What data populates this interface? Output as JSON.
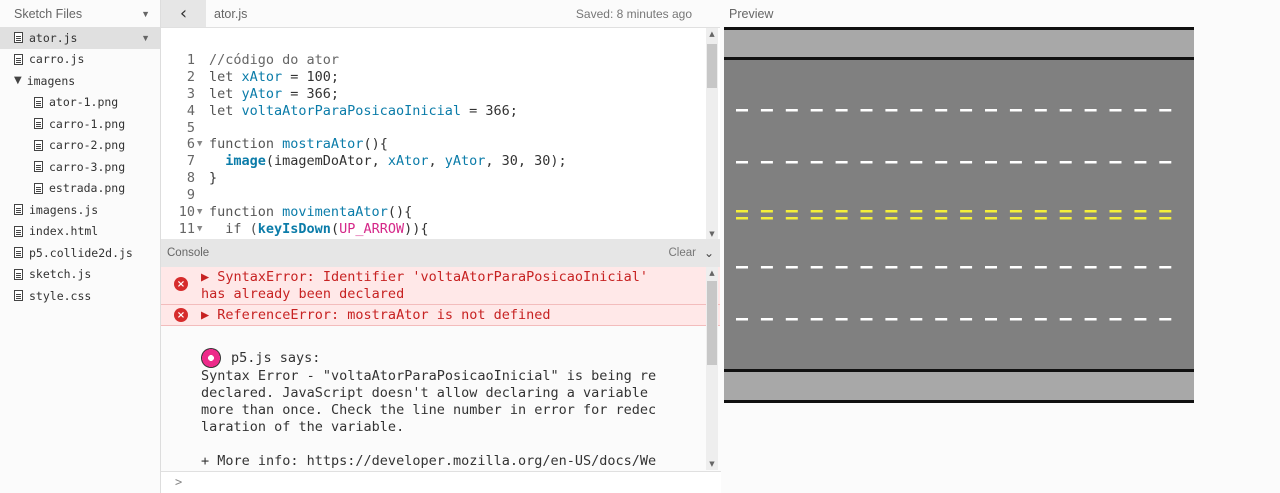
{
  "sidebar": {
    "title": "Sketch Files",
    "files": [
      {
        "label": "ator.js",
        "type": "file",
        "selected": true,
        "indent": 0
      },
      {
        "label": "carro.js",
        "type": "file",
        "indent": 0
      },
      {
        "label": "imagens",
        "type": "folder",
        "indent": 0
      },
      {
        "label": "ator-1.png",
        "type": "file",
        "indent": 1
      },
      {
        "label": "carro-1.png",
        "type": "file",
        "indent": 1
      },
      {
        "label": "carro-2.png",
        "type": "file",
        "indent": 1
      },
      {
        "label": "carro-3.png",
        "type": "file",
        "indent": 1
      },
      {
        "label": "estrada.png",
        "type": "file",
        "indent": 1
      },
      {
        "label": "imagens.js",
        "type": "file",
        "indent": 0
      },
      {
        "label": "index.html",
        "type": "file",
        "indent": 0
      },
      {
        "label": "p5.collide2d.js",
        "type": "file",
        "indent": 0
      },
      {
        "label": "sketch.js",
        "type": "file",
        "indent": 0
      },
      {
        "label": "style.css",
        "type": "file",
        "indent": 0
      }
    ]
  },
  "editor": {
    "filename": "ator.js",
    "saved": "Saved: 8 minutes ago",
    "lines": [
      {
        "n": "1",
        "fold": "",
        "tokens": [
          {
            "t": "//código do ator",
            "c": "comment"
          }
        ]
      },
      {
        "n": "2",
        "fold": "",
        "tokens": [
          {
            "t": "let ",
            "c": "kw"
          },
          {
            "t": "xAtor",
            "c": "var"
          },
          {
            "t": " = 100;",
            "c": "ctext"
          }
        ]
      },
      {
        "n": "3",
        "fold": "",
        "tokens": [
          {
            "t": "let ",
            "c": "kw"
          },
          {
            "t": "yAtor",
            "c": "var"
          },
          {
            "t": " = 366;",
            "c": "ctext"
          }
        ]
      },
      {
        "n": "4",
        "fold": "",
        "tokens": [
          {
            "t": "let ",
            "c": "kw"
          },
          {
            "t": "voltaAtorParaPosicaoInicial",
            "c": "var"
          },
          {
            "t": " = 366;",
            "c": "ctext"
          }
        ]
      },
      {
        "n": "5",
        "fold": "",
        "tokens": []
      },
      {
        "n": "6",
        "fold": "▼",
        "tokens": [
          {
            "t": "function ",
            "c": "kw"
          },
          {
            "t": "mostraAtor",
            "c": "fn"
          },
          {
            "t": "(){",
            "c": "ctext"
          }
        ]
      },
      {
        "n": "7",
        "fold": "",
        "tokens": [
          {
            "t": "  ",
            "c": "ctext"
          },
          {
            "t": "image",
            "c": "bold"
          },
          {
            "t": "(imagemDoAtor, ",
            "c": "ctext"
          },
          {
            "t": "xAtor",
            "c": "var"
          },
          {
            "t": ", ",
            "c": "ctext"
          },
          {
            "t": "yAtor",
            "c": "var"
          },
          {
            "t": ", 30, 30);",
            "c": "ctext"
          }
        ]
      },
      {
        "n": "8",
        "fold": "",
        "tokens": [
          {
            "t": "}",
            "c": "ctext"
          }
        ]
      },
      {
        "n": "9",
        "fold": "",
        "tokens": []
      },
      {
        "n": "10",
        "fold": "▼",
        "tokens": [
          {
            "t": "function ",
            "c": "kw"
          },
          {
            "t": "movimentaAtor",
            "c": "fn"
          },
          {
            "t": "(){",
            "c": "ctext"
          }
        ]
      },
      {
        "n": "11",
        "fold": "▼",
        "tokens": [
          {
            "t": "  if (",
            "c": "kw"
          },
          {
            "t": "keyIsDown",
            "c": "bold"
          },
          {
            "t": "(",
            "c": "ctext"
          },
          {
            "t": "UP_ARROW",
            "c": "const"
          },
          {
            "t": ")){",
            "c": "ctext"
          }
        ]
      }
    ]
  },
  "console": {
    "title": "Console",
    "clear_label": "Clear",
    "errors": [
      {
        "text": "▶ SyntaxError: Identifier 'voltaAtorParaPosicaoInicial'\nhas already been declared"
      },
      {
        "text": "▶ ReferenceError: mostraAtor is not defined"
      }
    ],
    "friendly": {
      "header": "p5.js says:",
      "body": "Syntax Error - \"voltaAtorParaPosicaoInicial\" is being re\ndeclared. JavaScript doesn't allow declaring a variable\nmore than once. Check the line number in error for redec\nlaration of the variable.",
      "more_info": "+ More info: https://developer.mozilla.org/en-US/docs/We"
    },
    "prompt": ">"
  },
  "preview": {
    "label": "Preview",
    "road": {
      "shoulder_color": "#a8a8a8",
      "asphalt_color": "#808080",
      "edge_line_color": "#111111",
      "white_dash_color": "#ffffff",
      "yellow_dash_color": "#f4ef3a"
    }
  }
}
